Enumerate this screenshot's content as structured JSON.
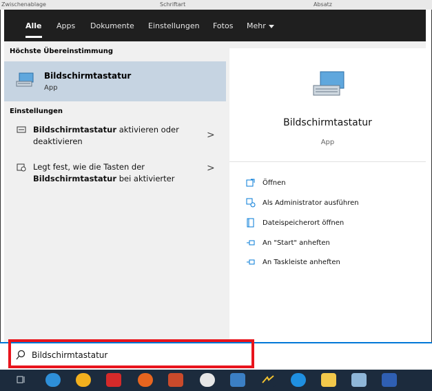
{
  "ribbon": {
    "groups": [
      "Zwischenablage",
      "Schriftart",
      "Absatz"
    ]
  },
  "tabs": [
    {
      "label": "Alle",
      "active": true
    },
    {
      "label": "Apps",
      "active": false
    },
    {
      "label": "Dokumente",
      "active": false
    },
    {
      "label": "Einstellungen",
      "active": false
    },
    {
      "label": "Fotos",
      "active": false
    },
    {
      "label": "Mehr",
      "active": false
    }
  ],
  "left": {
    "best_match_heading": "Höchste Übereinstimmung",
    "best_match": {
      "name": "Bildschirmtastatur",
      "type": "App",
      "icon": "keyboard-monitor-icon"
    },
    "settings_heading": "Einstellungen",
    "results": [
      {
        "bold": "Bildschirmtastatur",
        "rest_line1": " aktivieren oder",
        "line2": "deaktivieren",
        "icon": "keyboard-icon"
      },
      {
        "line1": "Legt fest, wie die Tasten der",
        "bold": "Bildschirmtastatur",
        "rest_line2": " bei aktivierter",
        "icon": "accessibility-icon"
      }
    ]
  },
  "right": {
    "app_title": "Bildschirmtastatur",
    "app_type": "App",
    "actions": [
      {
        "label": "Öffnen",
        "icon": "open-icon"
      },
      {
        "label": "Als Administrator ausführen",
        "icon": "admin-shield-icon"
      },
      {
        "label": "Dateispeicherort öffnen",
        "icon": "file-location-icon"
      },
      {
        "label": "An \"Start\" anheften",
        "icon": "pin-icon"
      },
      {
        "label": "An Taskleiste anheften",
        "icon": "pin-icon"
      }
    ]
  },
  "search": {
    "value": "Bildschirmtastatur",
    "icon": "search-icon",
    "highlight_color": "#e8141c"
  },
  "taskbar": {
    "apps": [
      "task-view-icon",
      "edge-icon",
      "chrome-icon",
      "avira-icon",
      "firefox-icon",
      "powerpoint-icon",
      "app-icon",
      "outlook-icon",
      "paint-icon",
      "skype-icon",
      "explorer-icon",
      "snipping-icon",
      "word-icon"
    ]
  },
  "colors": {
    "accent": "#0078d7",
    "selected": "#c6d4e2",
    "tabbar": "#1f1f1f",
    "taskbar": "#1c2b3d"
  }
}
